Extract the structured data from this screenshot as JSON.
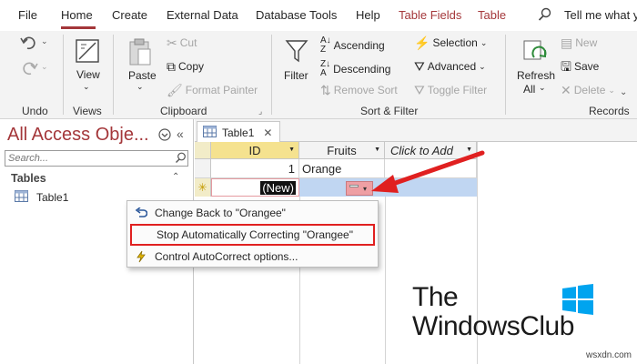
{
  "menu": {
    "items": [
      "File",
      "Home",
      "Create",
      "External Data",
      "Database Tools",
      "Help"
    ],
    "contextual": [
      "Table Fields",
      "Table"
    ],
    "tell_me": "Tell me what y"
  },
  "ribbon": {
    "undo_label": "Undo",
    "views": {
      "view": "View",
      "label": "Views"
    },
    "clipboard": {
      "paste": "Paste",
      "cut": "Cut",
      "copy": "Copy",
      "format_painter": "Format Painter",
      "label": "Clipboard"
    },
    "sort_filter": {
      "filter": "Filter",
      "ascending": "Ascending",
      "descending": "Descending",
      "remove_sort": "Remove Sort",
      "selection": "Selection",
      "advanced": "Advanced",
      "toggle_filter": "Toggle Filter",
      "label": "Sort & Filter"
    },
    "records": {
      "refresh": "Refresh",
      "all": "All",
      "new": "New",
      "save": "Save",
      "delete": "Delete",
      "label": "Records"
    }
  },
  "nav": {
    "title": "All Access Obje...",
    "search_placeholder": "Search...",
    "section": "Tables",
    "items": [
      "Table1"
    ]
  },
  "document": {
    "tab": "Table1",
    "columns": [
      "ID",
      "Fruits",
      "Click to Add"
    ],
    "rows": [
      {
        "id": "1",
        "fruits": "Orange"
      }
    ],
    "new_row_marker": "(New)"
  },
  "context_menu": {
    "items": [
      "Change Back to \"Orangee\"",
      "Stop Automatically Correcting \"Orangee\"",
      "Control AutoCorrect options..."
    ]
  },
  "watermark": {
    "line1": "The",
    "line2": "WindowsClub"
  },
  "footer": "wsxdn.com",
  "colors": {
    "accent": "#a4373a",
    "highlight_box": "#e02020",
    "arrow": "#e02020"
  }
}
